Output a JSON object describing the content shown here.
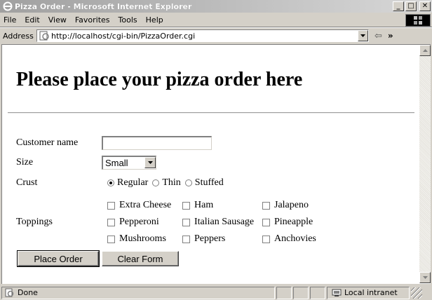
{
  "window": {
    "title": "Pizza Order - Microsoft Internet Explorer",
    "minimize_icon": "minimize-icon",
    "maximize_icon": "maximize-icon",
    "close_icon": "close-icon"
  },
  "menu": {
    "items": [
      "File",
      "Edit",
      "View",
      "Favorites",
      "Tools",
      "Help"
    ]
  },
  "address": {
    "label": "Address",
    "url": "http://localhost/cgi-bin/PizzaOrder.cgi"
  },
  "page": {
    "heading": "Please place your pizza order here",
    "form": {
      "customer_label": "Customer name",
      "customer_value": "",
      "size_label": "Size",
      "size_value": "Small",
      "crust_label": "Crust",
      "crust_options": [
        {
          "label": "Regular",
          "checked": true
        },
        {
          "label": "Thin",
          "checked": false
        },
        {
          "label": "Stuffed",
          "checked": false
        }
      ],
      "toppings_label": "Toppings",
      "toppings": [
        {
          "label": "Extra Cheese",
          "checked": false
        },
        {
          "label": "Ham",
          "checked": false
        },
        {
          "label": "Jalapeno",
          "checked": false
        },
        {
          "label": "Pepperoni",
          "checked": false
        },
        {
          "label": "Italian Sausage",
          "checked": false
        },
        {
          "label": "Pineapple",
          "checked": false
        },
        {
          "label": "Mushrooms",
          "checked": false
        },
        {
          "label": "Peppers",
          "checked": false
        },
        {
          "label": "Anchovies",
          "checked": false
        }
      ],
      "submit_label": "Place Order",
      "reset_label": "Clear Form"
    }
  },
  "status": {
    "text": "Done",
    "zone": "Local intranet"
  }
}
